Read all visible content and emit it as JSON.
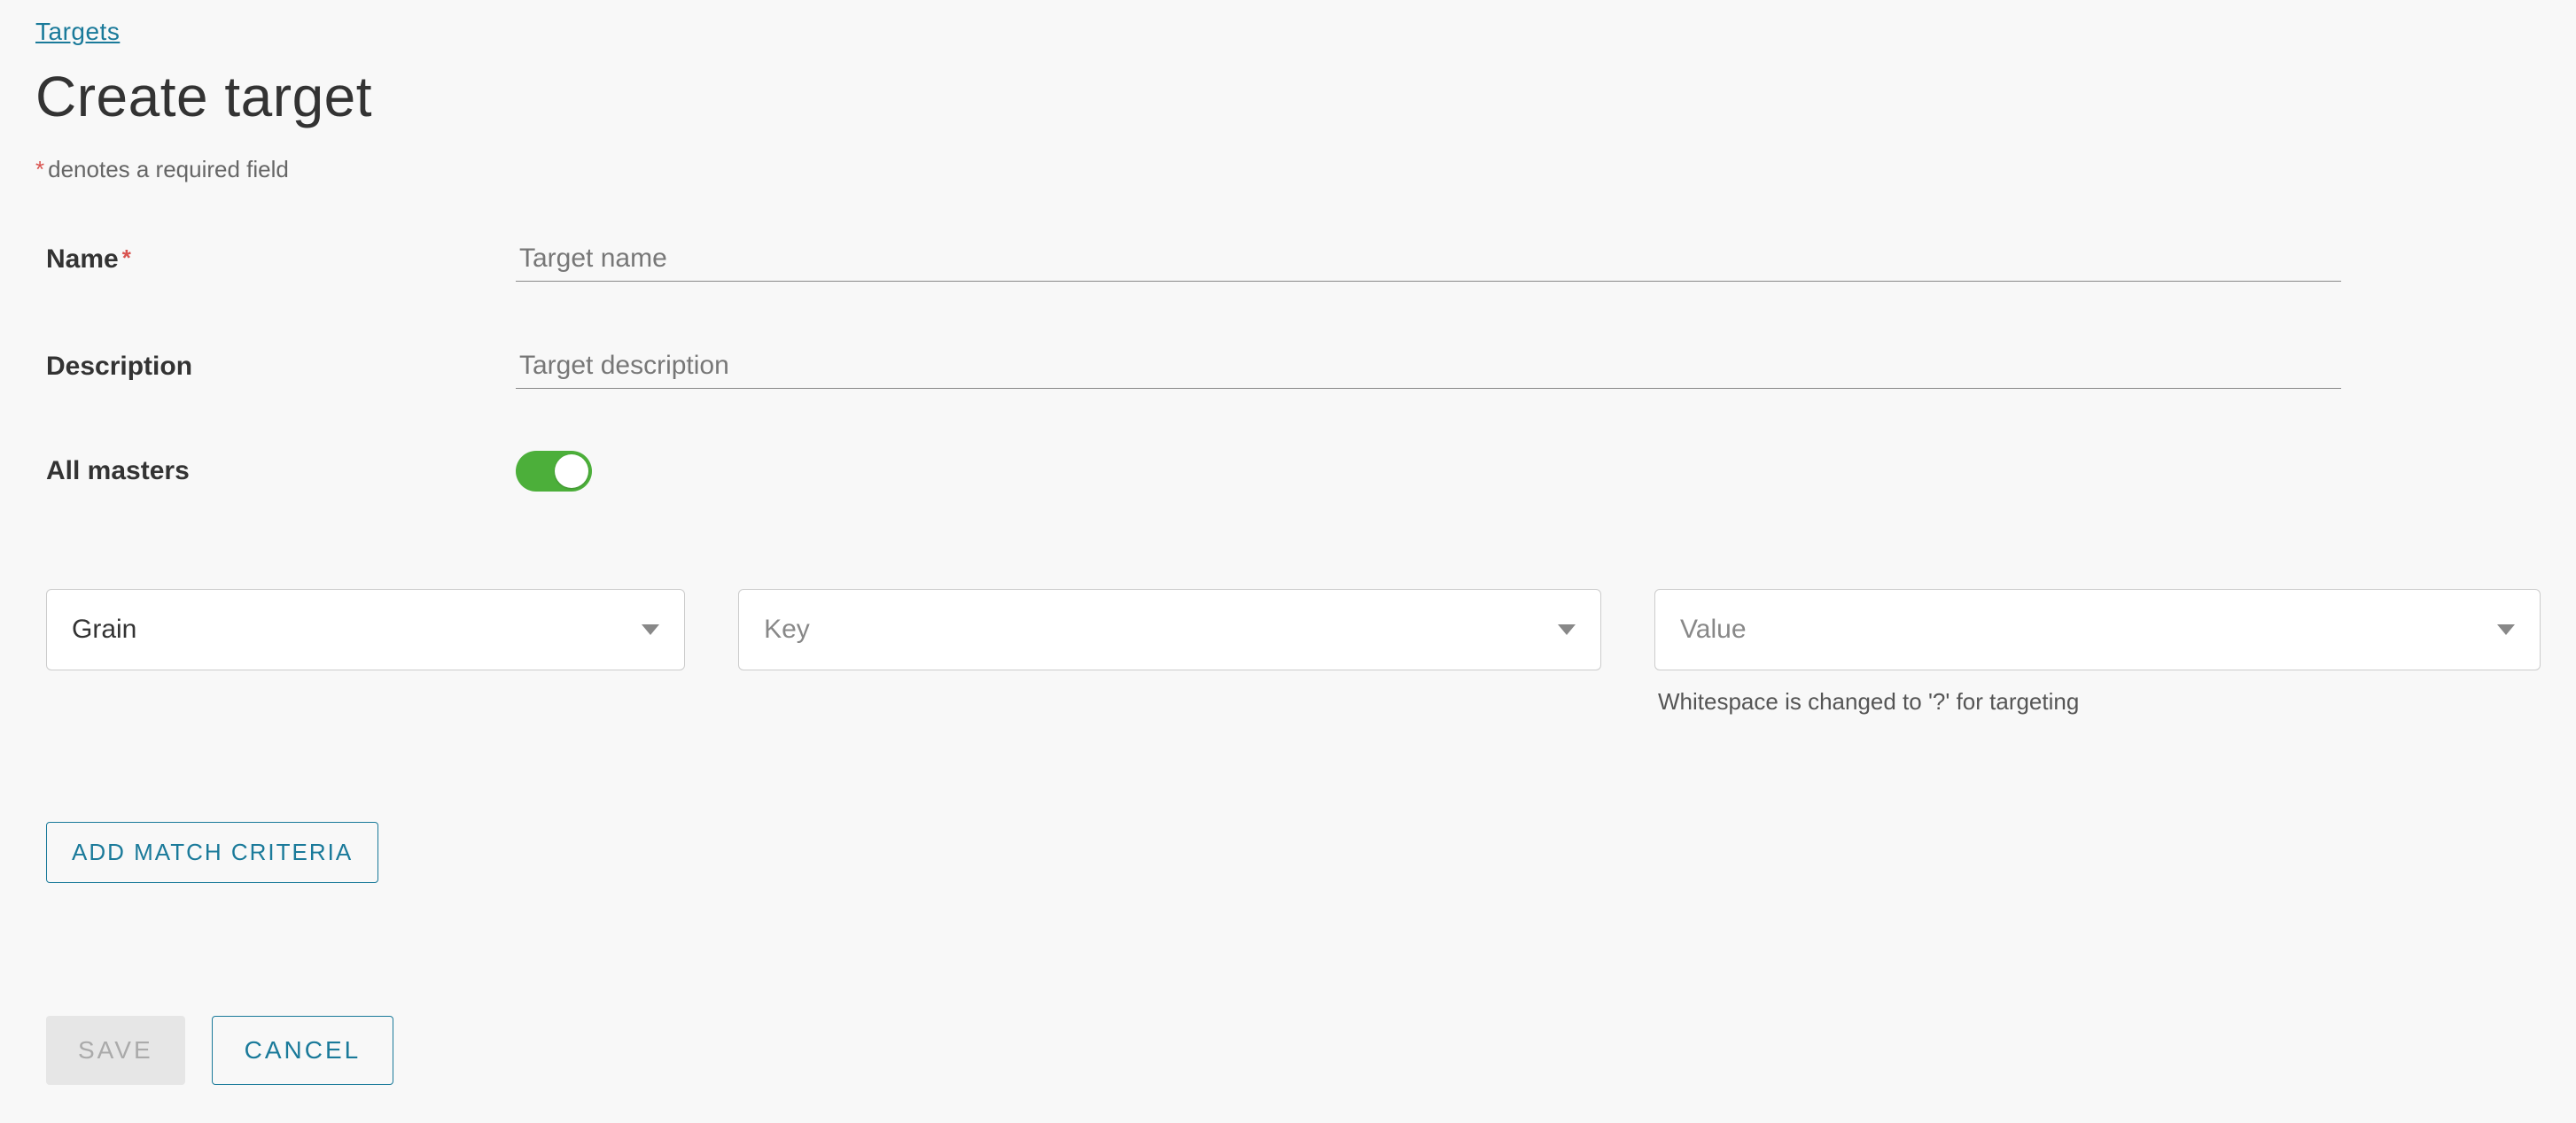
{
  "breadcrumb": {
    "targets": "Targets"
  },
  "title": "Create target",
  "required_note": "denotes a required field",
  "form": {
    "name_label": "Name",
    "name_placeholder": "Target name",
    "name_value": "",
    "description_label": "Description",
    "description_placeholder": "Target description",
    "description_value": "",
    "all_masters_label": "All masters",
    "all_masters_on": true
  },
  "criteria": {
    "grain_selected": "Grain",
    "key_placeholder": "Key",
    "value_placeholder": "Value",
    "value_helper": "Whitespace is changed to '?' for targeting"
  },
  "buttons": {
    "add_criteria": "ADD MATCH CRITERIA",
    "save": "SAVE",
    "cancel": "CANCEL"
  }
}
